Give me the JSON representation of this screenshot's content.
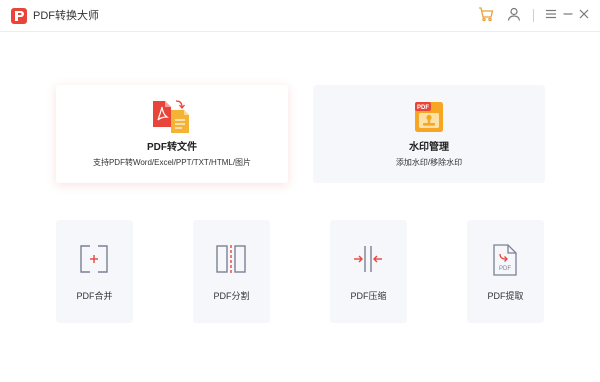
{
  "app": {
    "title": "PDF转换大师"
  },
  "features": [
    {
      "title": "PDF转文件",
      "desc": "支持PDF转Word/Excel/PPT/TXT/HTML/图片"
    },
    {
      "title": "水印管理",
      "desc": "添加水印/移除水印"
    }
  ],
  "tools": [
    {
      "label": "PDF合并",
      "icon": "merge-icon"
    },
    {
      "label": "PDF分割",
      "icon": "split-icon"
    },
    {
      "label": "PDF压缩",
      "icon": "compress-icon"
    },
    {
      "label": "PDF提取",
      "icon": "extract-icon"
    }
  ],
  "icon_badges": {
    "watermark_badge": "PDF",
    "extract_badge": "PDF"
  },
  "colors": {
    "accent": "#e8443a",
    "orange": "#f5a623",
    "card_bg": "#f6f7fb",
    "icon_gray": "#7a8194"
  }
}
